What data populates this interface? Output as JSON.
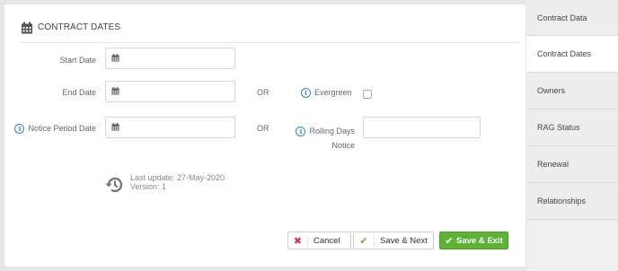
{
  "section": {
    "title": "CONTRACT DATES",
    "icon": "calendar-icon"
  },
  "fields": {
    "start_date": {
      "label": "Start Date",
      "value": ""
    },
    "end_date": {
      "label": "End Date",
      "value": ""
    },
    "notice_period_date": {
      "label": "Notice Period Date",
      "value": ""
    },
    "evergreen": {
      "label": "Evergreen",
      "checked": false
    },
    "rolling_days_notice": {
      "label_line1": "Rolling Days",
      "label_line2": "Notice",
      "value": ""
    }
  },
  "or_text": "OR",
  "update": {
    "last_update": "Last update: 27-May-2020",
    "version": "Version: 1"
  },
  "buttons": {
    "cancel": "Cancel",
    "save_next": "Save & Next",
    "save_exit": "Save & Exit"
  },
  "sidebar": {
    "items": [
      {
        "label": "Contract Data",
        "active": false
      },
      {
        "label": "Contract Dates",
        "active": true
      },
      {
        "label": "Owners",
        "active": false
      },
      {
        "label": "RAG Status",
        "active": false
      },
      {
        "label": "Renewal",
        "active": false
      },
      {
        "label": "Relationships",
        "active": false
      }
    ]
  },
  "colors": {
    "accent_green": "#5cb336",
    "info_blue": "#2f86c9",
    "cancel_red": "#d9333f"
  }
}
